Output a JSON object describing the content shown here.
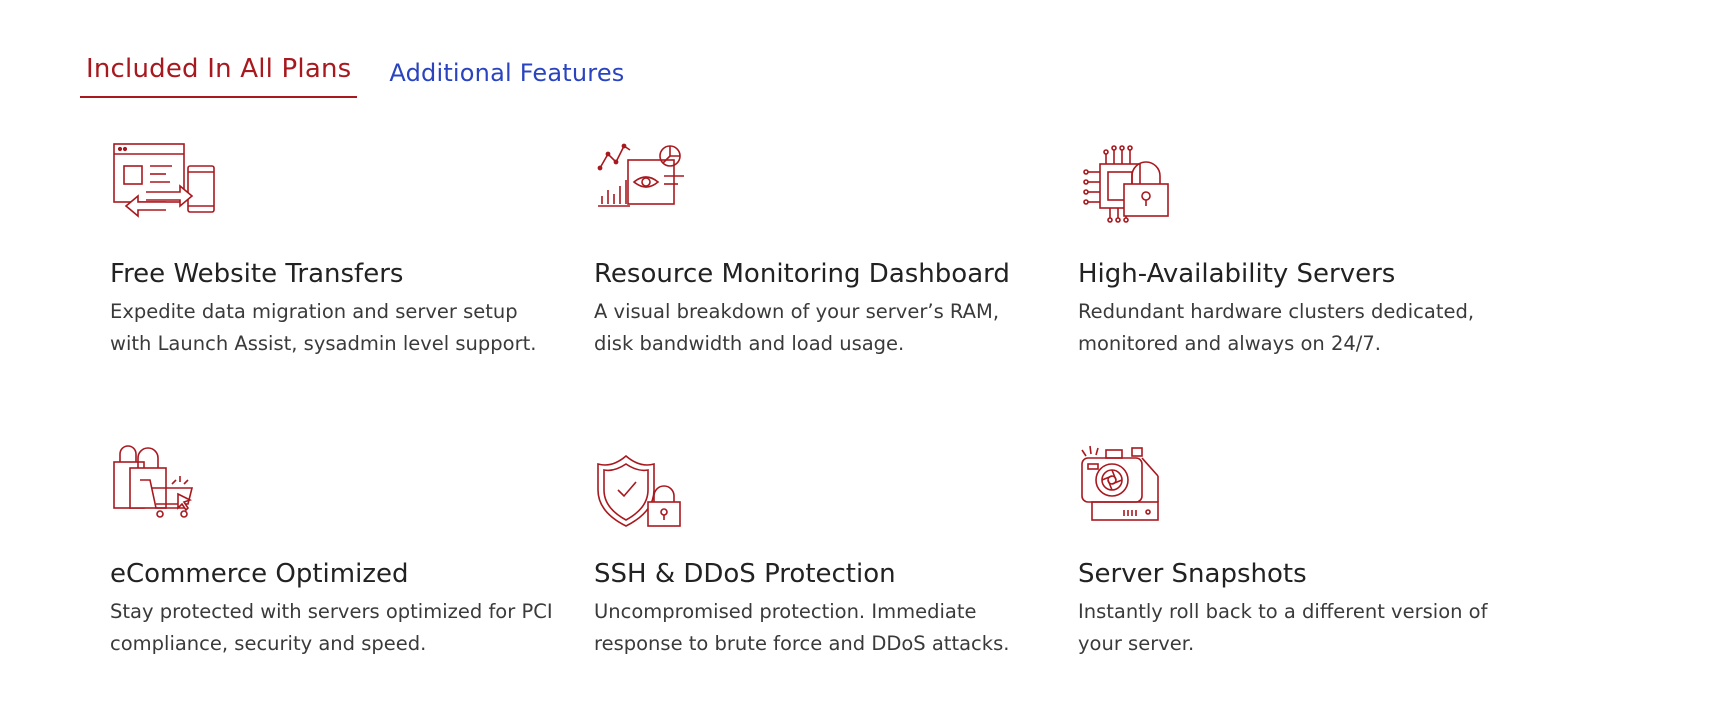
{
  "tabs": [
    {
      "label": "Included In All Plans",
      "active": true
    },
    {
      "label": "Additional Features",
      "active": false
    }
  ],
  "features": [
    {
      "icon": "website-transfer-icon",
      "title": "Free Website Transfers",
      "description": "Expedite data migration and server setup with Launch Assist, sysadmin level support."
    },
    {
      "icon": "monitoring-dashboard-icon",
      "title": "Resource Monitoring Dashboard",
      "description": "A visual breakdown of your server’s RAM, disk bandwidth and load usage."
    },
    {
      "icon": "high-availability-servers-icon",
      "title": "High-Availability Servers",
      "description": "Redundant hardware clusters dedicated, monitored and always on 24/7."
    },
    {
      "icon": "ecommerce-cart-icon",
      "title": "eCommerce Optimized",
      "description": "Stay protected with servers optimized for PCI compliance, security and speed."
    },
    {
      "icon": "shield-lock-icon",
      "title": "SSH & DDoS Protection",
      "description": "Uncompromised protection. Immediate response to brute force and DDoS attacks."
    },
    {
      "icon": "camera-snapshot-icon",
      "title": "Server Snapshots",
      "description": "Instantly roll back to a different version of your server."
    }
  ],
  "colors": {
    "accent": "#a8191f",
    "link": "#2a44c0",
    "text": "#2a2a2a"
  }
}
